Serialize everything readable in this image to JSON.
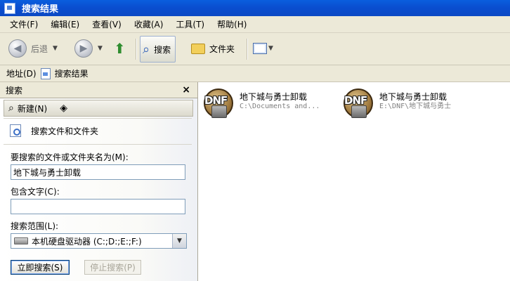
{
  "window": {
    "title": "搜索结果"
  },
  "menu": [
    "文件(F)",
    "编辑(E)",
    "查看(V)",
    "收藏(A)",
    "工具(T)",
    "帮助(H)"
  ],
  "toolbar": {
    "back_label": "后退",
    "search_label": "搜索",
    "folders_label": "文件夹"
  },
  "address": {
    "label": "地址(D)",
    "value": "搜索结果"
  },
  "search_pane": {
    "header": "搜索",
    "close": "×",
    "new_label": "新建(N)",
    "heading": "搜索文件和文件夹",
    "name_label": "要搜索的文件或文件夹名为(M):",
    "name_value": "地下城与勇士卸载",
    "text_label": "包含文字(C):",
    "text_value": "",
    "scope_label": "搜索范围(L):",
    "scope_value": "本机硬盘驱动器 (C:;D:;E:;F:)",
    "search_now": "立即搜索(S)",
    "stop": "停止搜索(P)"
  },
  "results": [
    {
      "name": "地下城与勇士卸载",
      "path": "C:\\Documents and...",
      "logo_text": "DNF"
    },
    {
      "name": "地下城与勇士卸载",
      "path": "E:\\DNF\\地下城与勇士",
      "logo_text": "DNF"
    }
  ]
}
